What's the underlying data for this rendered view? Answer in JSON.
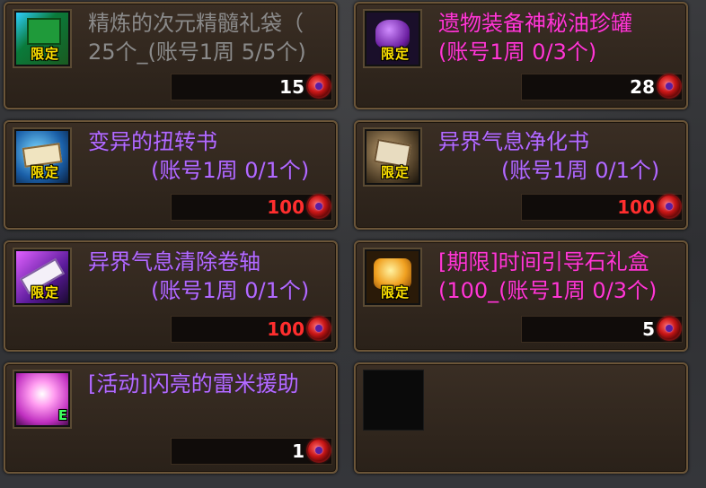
{
  "badge_label": "限定",
  "currency_icon": "red-orb-icon",
  "items": [
    {
      "title": "精炼的次元精髓礼袋（",
      "sub": "25个_(账号1周 5/5个)",
      "price": "15",
      "name_color": "gray",
      "price_color": "white",
      "icon": "green-bag-icon"
    },
    {
      "title": "遗物装备神秘油珍罐",
      "sub": "(账号1周 0/3个)",
      "price": "28",
      "name_color": "pink",
      "price_color": "white",
      "icon": "purple-jar-icon"
    },
    {
      "title": "变异的扭转书",
      "sub": "(账号1周 0/1个)",
      "price": "100",
      "name_color": "purple",
      "price_color": "red",
      "icon": "blue-book-icon"
    },
    {
      "title": "异界气息净化书",
      "sub": "(账号1周 0/1个)",
      "price": "100",
      "name_color": "purple",
      "price_color": "red",
      "icon": "scroll-book-icon"
    },
    {
      "title": "异界气息清除卷轴",
      "sub": "(账号1周 0/1个)",
      "price": "100",
      "name_color": "purple",
      "price_color": "red",
      "icon": "scroll-icon"
    },
    {
      "title": "[期限]时间引导石礼盒",
      "sub": "(100_(账号1周 0/3个)",
      "price": "5",
      "name_color": "pink",
      "price_color": "white",
      "icon": "gold-box-icon"
    },
    {
      "title": "[活动]闪亮的雷米援助",
      "sub": "",
      "price": "1",
      "name_color": "purple",
      "price_color": "white",
      "icon": "pink-glow-icon"
    },
    {
      "title": "",
      "sub": "",
      "price": "",
      "name_color": "",
      "price_color": "",
      "icon": "empty-slot"
    }
  ]
}
